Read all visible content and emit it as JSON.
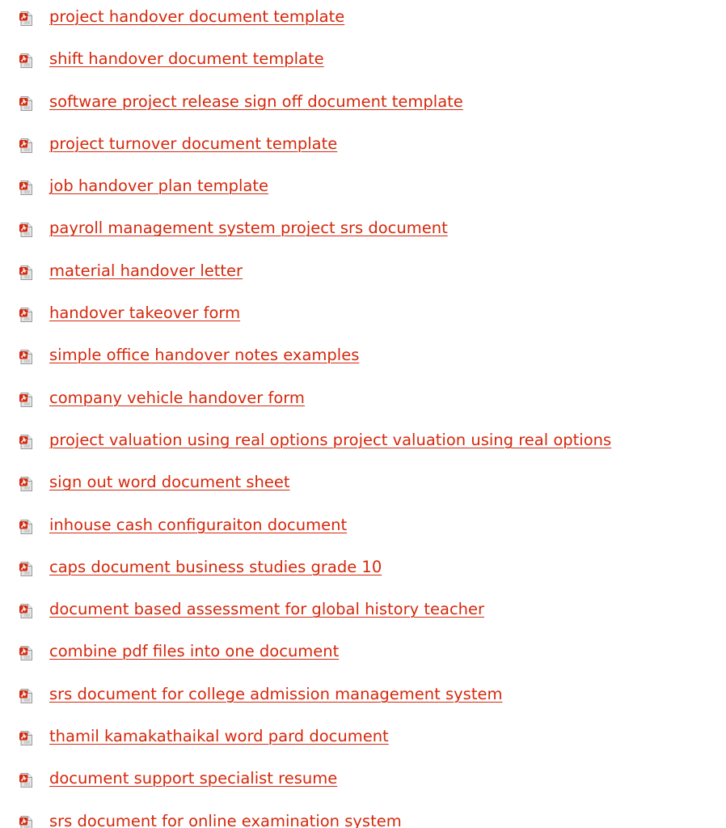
{
  "icon": "pdf-file-icon",
  "colors": {
    "link": "#d5280c",
    "icon_red": "#d42a10",
    "icon_page": "#dedede"
  },
  "results": [
    {
      "label": "project handover document template"
    },
    {
      "label": "shift handover document template"
    },
    {
      "label": "software project release sign off document template"
    },
    {
      "label": "project turnover document template"
    },
    {
      "label": "job handover plan template"
    },
    {
      "label": "payroll management system project srs document"
    },
    {
      "label": "material handover letter"
    },
    {
      "label": "handover takeover form"
    },
    {
      "label": "simple office handover notes examples"
    },
    {
      "label": "company vehicle handover form"
    },
    {
      "label": "project valuation using real options project valuation using real options"
    },
    {
      "label": "sign out word document sheet"
    },
    {
      "label": "inhouse cash configuraiton document"
    },
    {
      "label": "caps document business studies grade 10"
    },
    {
      "label": "document based assessment for global history teacher"
    },
    {
      "label": "combine pdf files into one document"
    },
    {
      "label": "srs document for college admission management system"
    },
    {
      "label": "thamil kamakathaikal word pard document"
    },
    {
      "label": "document support specialist resume"
    },
    {
      "label": "srs document for online examination system"
    }
  ]
}
